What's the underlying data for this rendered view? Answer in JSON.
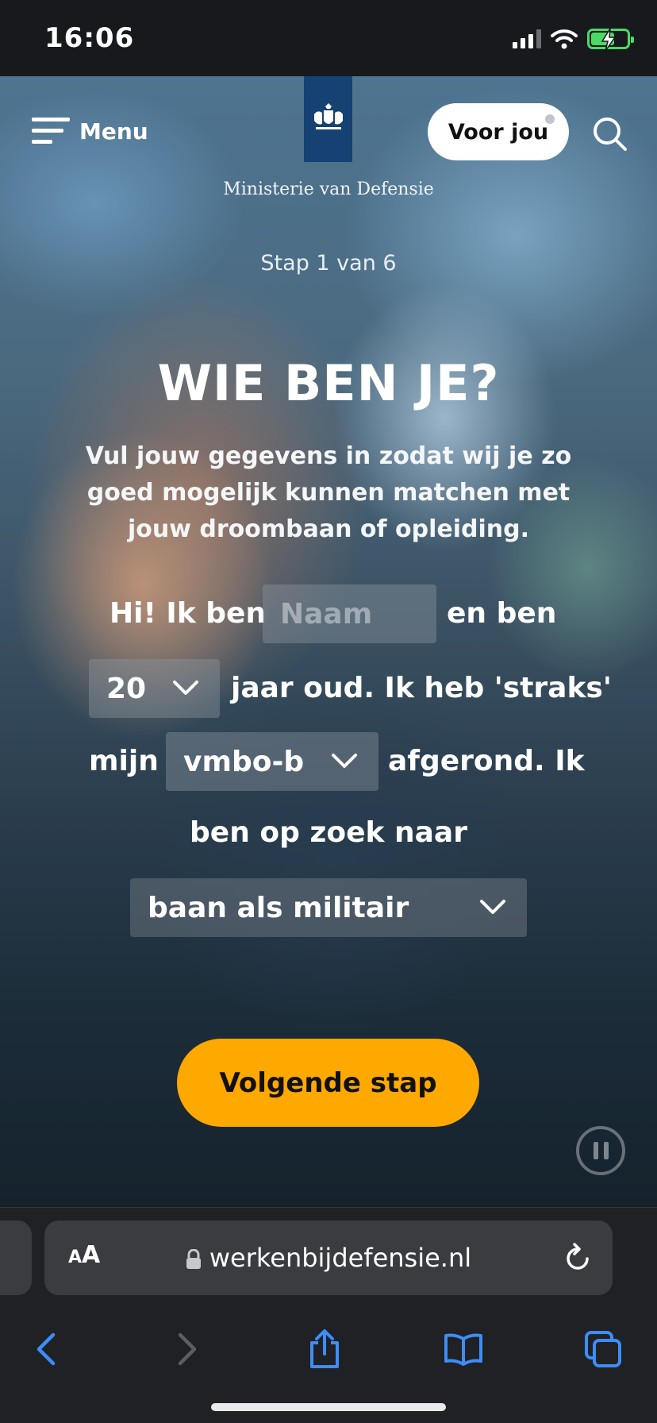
{
  "status_bar": {
    "time": "16:06"
  },
  "header": {
    "menu_label": "Menu",
    "ministry": "Ministerie van Defensie",
    "voor_jou_label": "Voor jou"
  },
  "page": {
    "step": "Stap 1 van 6",
    "title": "WIE BEN JE?",
    "intro": "Vul jouw gegevens in zodat wij je zo goed mogelijk kunnen matchen met jouw droombaan of opleiding."
  },
  "form": {
    "hi_text": "Hi! Ik ben",
    "name_placeholder": "Naam",
    "en_ben": "en ben",
    "age_value": "20",
    "jaar_text": "jaar oud. Ik heb 'straks'",
    "mijn": "mijn",
    "education_value": "vmbo-b",
    "afgerond": "afgerond. Ik",
    "zoek_text": "ben op zoek naar",
    "looking_for_value": "baan als militair",
    "next_button": "Volgende stap"
  },
  "browser": {
    "aa_big": "A",
    "aa_small": "A",
    "url": "werkenbijdefensie.nl"
  },
  "colors": {
    "cta": "#ffa800",
    "logo_blue": "#154273",
    "browser_accent": "#3e8df7"
  },
  "icons": [
    "menu-icon",
    "search-icon",
    "chevron-down-icon",
    "pause-icon",
    "lock-icon",
    "reload-icon",
    "back-icon",
    "forward-icon",
    "share-icon",
    "bookmarks-icon",
    "tabs-icon"
  ]
}
